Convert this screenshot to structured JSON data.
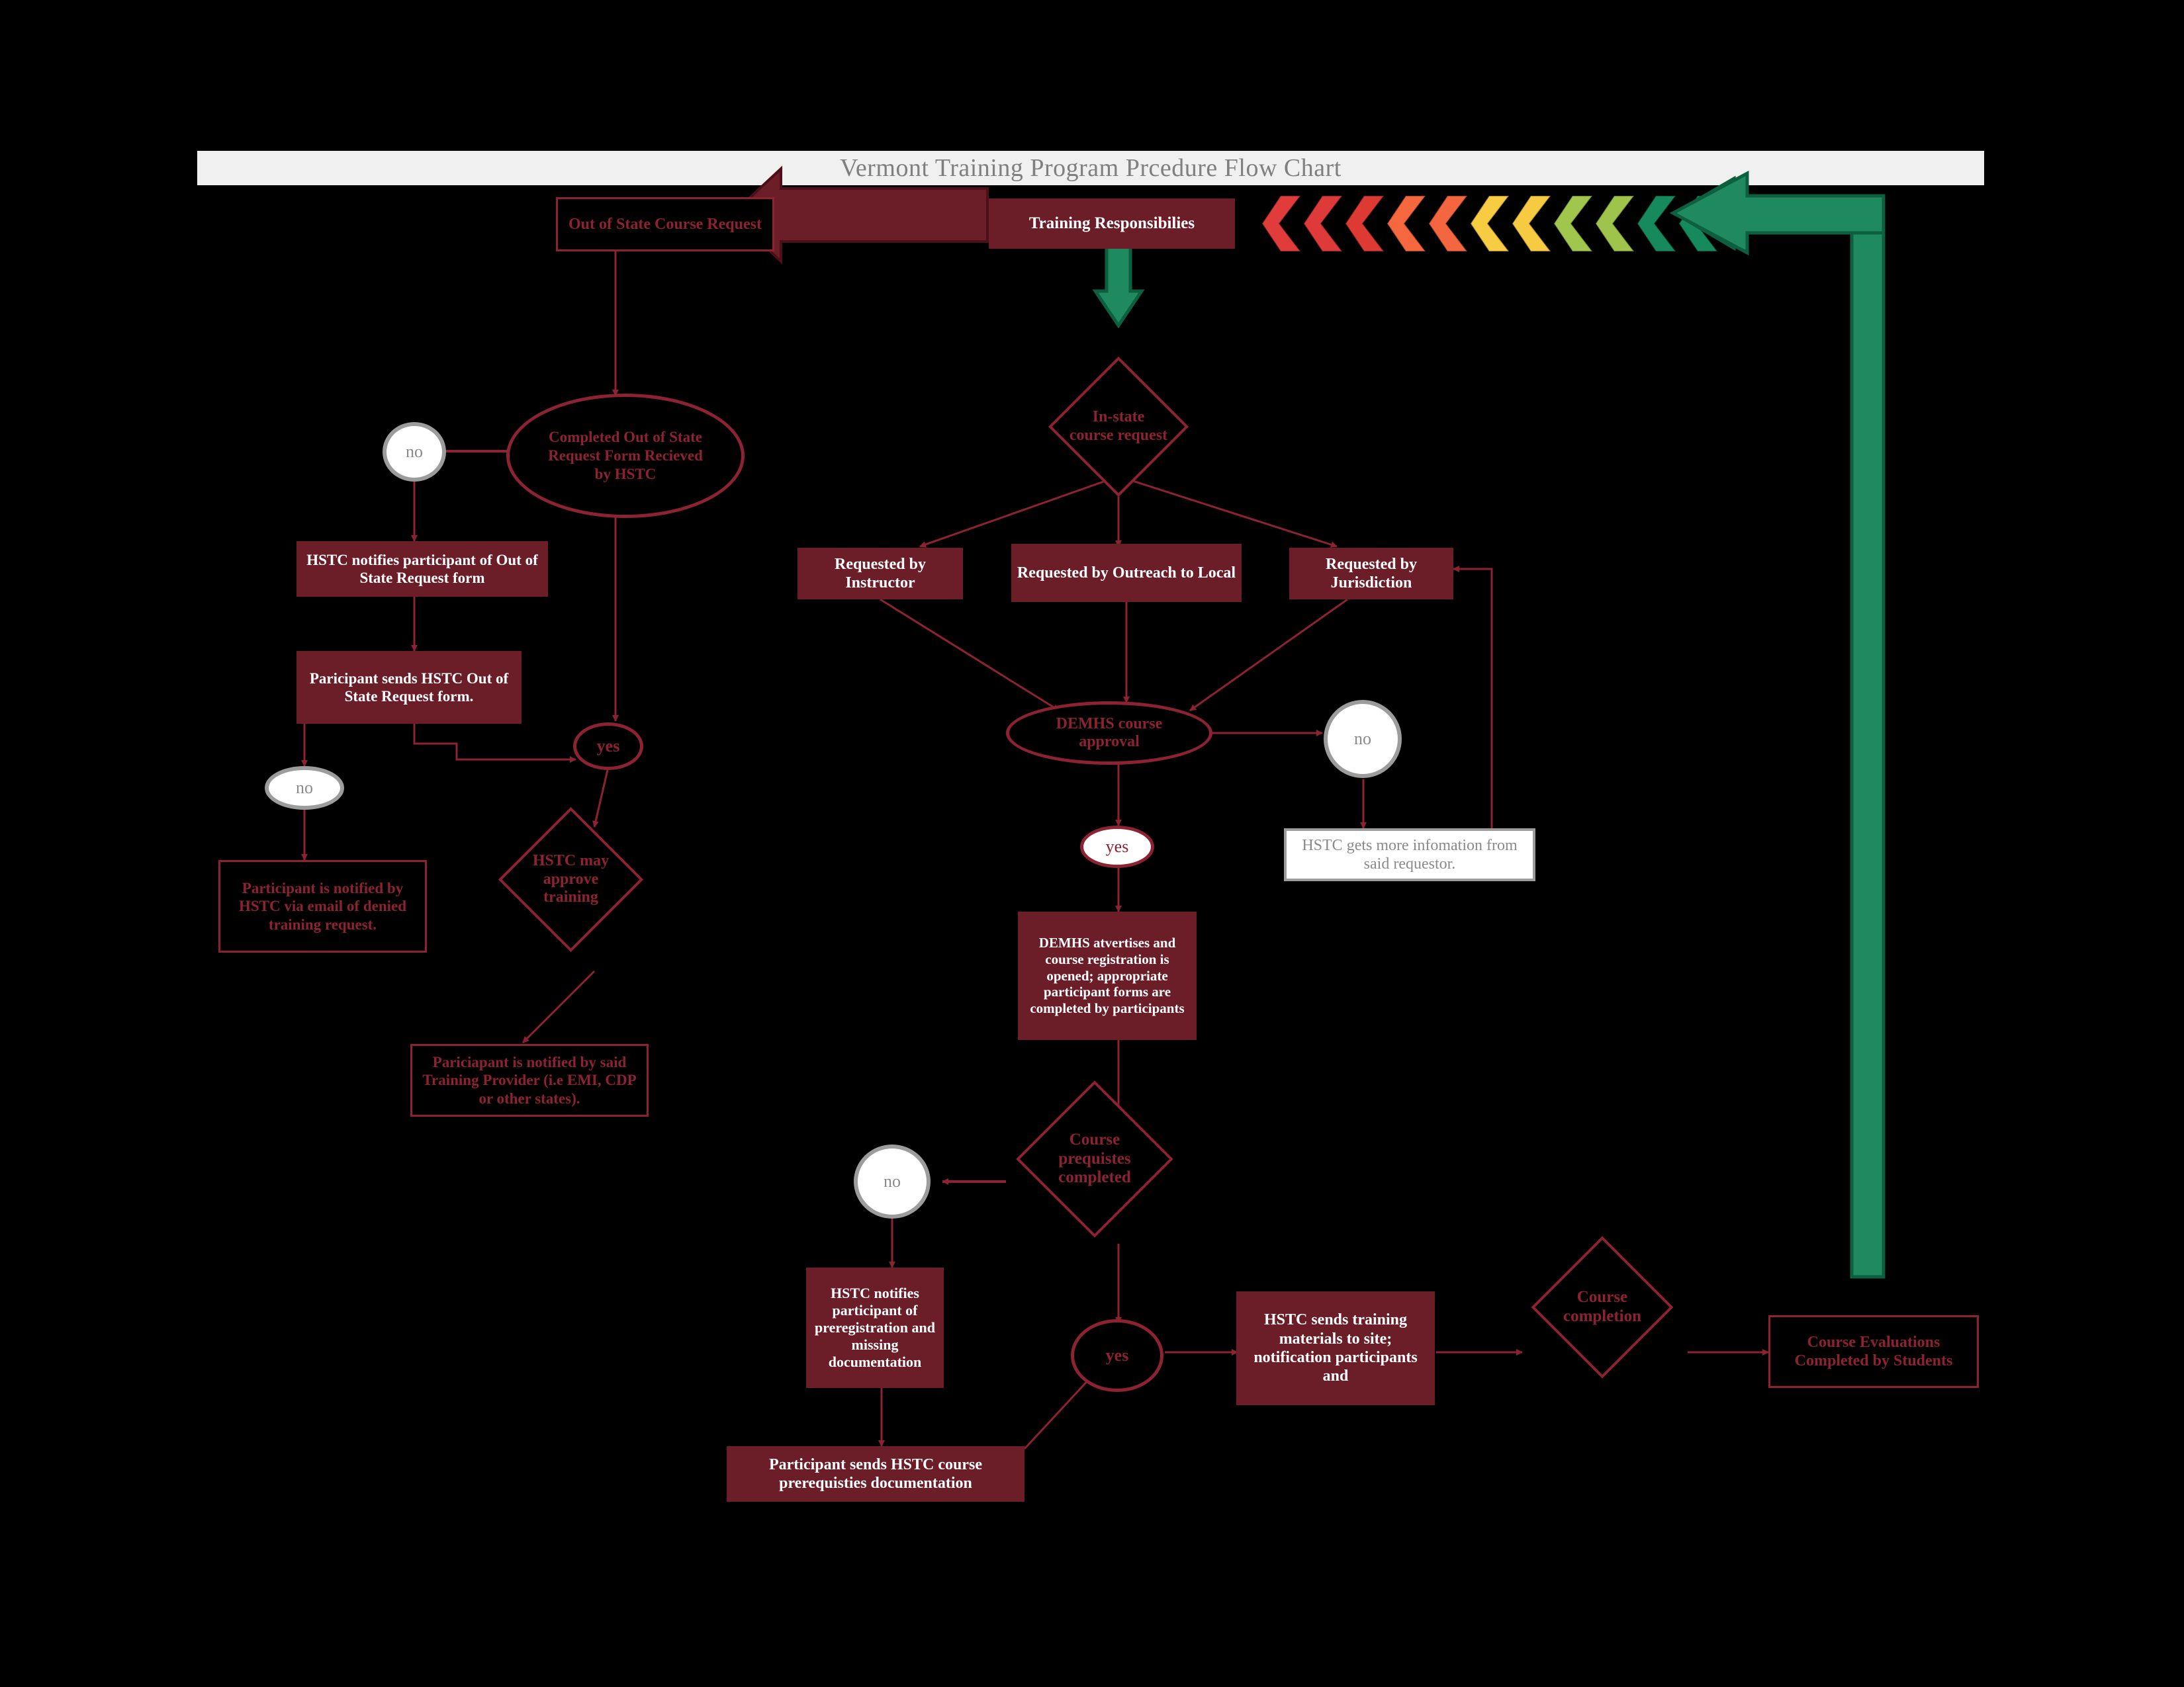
{
  "header": {
    "title": "Vermont Training Program Prcedure Flow Chart"
  },
  "colors": {
    "background": "#000000",
    "header_bar": "#f0f0f0",
    "header_text": "#7f7f7f",
    "maroon_fill": "#6b1d28",
    "maroon_line": "#8d2232",
    "gray_line": "#9c9c9c",
    "green_arrow": "#1f8a5f",
    "chevrons": [
      "#e03c3c",
      "#e03c3c",
      "#e0402f",
      "#f26946",
      "#f26946",
      "#f5c93f",
      "#f5c93f",
      "#9cc martin",
      "#9cc44c",
      "#1f8a5f",
      "#1f8a5f"
    ]
  },
  "chevron_colors": [
    "#e03c3c",
    "#dd3a39",
    "#dc3a33",
    "#f4673f",
    "#f3663f",
    "#f7cc43",
    "#f6ca41",
    "#a1c64d",
    "#9ec44c",
    "#16895d",
    "#16895d"
  ],
  "nodes": {
    "training_responsibilities": "Training Responsibilies",
    "out_of_state_course_request": "Out of State Course Request",
    "completed_oos_form": "Completed  Out of State Request Form Recieved by HSTC",
    "no_1": "no",
    "hstc_notifies_oos": "HSTC notifies participant of Out of State Request form",
    "paricipant_sends_oos": "Paricipant sends HSTC Out of State Request form.",
    "no_2": "no",
    "yes_1": "yes",
    "participant_denied": "Participant is notified by HSTC via email of denied training request.",
    "hstc_may_approve": "HSTC may approve training",
    "pariciapant_notified_provider": "Pariciapant is notified by said Training Provider (i.e EMI, CDP or other states).",
    "in_state_course_request": "In-state course request",
    "requested_by_instructor": "Requested by Instructor",
    "requested_by_outreach": "Requested by Outreach to Local",
    "requested_by_jurisdiction": "Requested by Jurisdiction",
    "demhs_course_approval": "DEMHS course approval",
    "no_3": "no",
    "hstc_gets_more_info": "HSTC gets more infomation from said requestor.",
    "yes_2": "yes",
    "demhs_advertises": "DEMHS atvertises and course registration is opened; appropriate participant forms are completed by participants",
    "course_prequistes": "Course prequistes completed",
    "no_4": "no",
    "hstc_notifies_prereg": "HSTC notifies participant of preregistration and missing documentation",
    "participant_sends_prereq": "Participant sends HSTC course prerequisties documentation",
    "yes_3": "yes",
    "hstc_sends_materials": "HSTC sends training materials to site; notification participants and",
    "course_completion": "Course completion",
    "course_evaluations": "Course Evaluations Completed by Students"
  }
}
